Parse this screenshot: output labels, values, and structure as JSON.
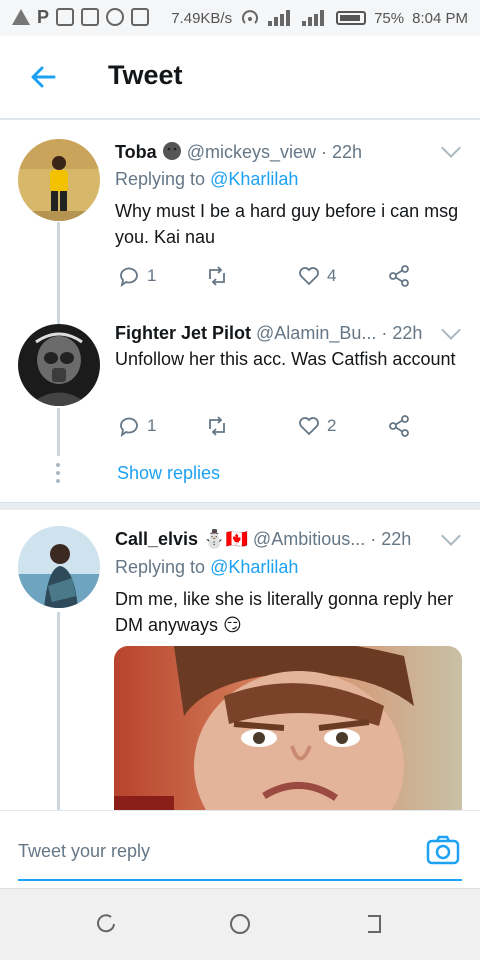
{
  "status_bar": {
    "speed": "7.49KB/s",
    "battery": "75%",
    "time": "8:04 PM"
  },
  "header": {
    "title": "Tweet",
    "back_icon": "arrow-left-icon"
  },
  "tweets": [
    {
      "name": "Toba",
      "handle": "@mickeys_view",
      "time": "· 22h",
      "replying_label": "Replying to",
      "replying_handle": "@Kharlilah",
      "text": "Why must I be a hard guy before i can msg you. Kai nau",
      "replies": "1",
      "retweets": "",
      "likes": "4"
    },
    {
      "name": "Fighter Jet Pilot",
      "handle": "@Alamin_Bu...",
      "time": "· 22h",
      "text": "Unfollow her this acc. Was Catfish account",
      "replies": "1",
      "retweets": "",
      "likes": "2"
    },
    {
      "name": "Call_elvis",
      "emojis": "⛄🇨🇦",
      "handle": "@Ambitious...",
      "time": "· 22h",
      "replying_label": "Replying to",
      "replying_handle": "@Kharlilah",
      "text": "Dm me, like she is literally gonna reply her DM anyways 😏"
    }
  ],
  "show_replies": "Show replies",
  "reply_bar": {
    "placeholder": "Tweet your reply",
    "camera_icon": "camera-icon"
  },
  "colors": {
    "accent": "#1da1f2",
    "muted": "#657786",
    "divider": "#e6ecf0"
  }
}
